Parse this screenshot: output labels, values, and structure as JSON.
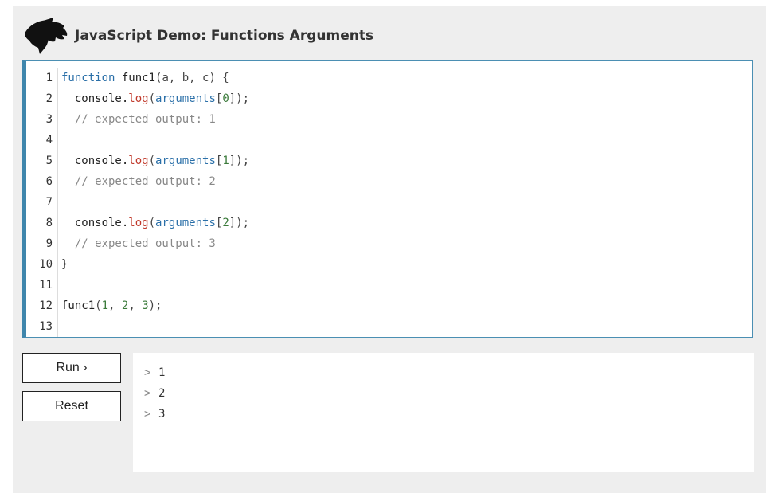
{
  "header": {
    "title": "JavaScript Demo: Functions Arguments",
    "logo_icon": "dinosaur-head-icon"
  },
  "editor": {
    "lines": [
      {
        "n": "1",
        "tokens": [
          [
            "kw",
            "function"
          ],
          [
            "fn",
            " func1"
          ],
          [
            "punc",
            "(a, b, c) {"
          ]
        ]
      },
      {
        "n": "2",
        "tokens": [
          [
            "fn",
            "  console."
          ],
          [
            "prop",
            "log"
          ],
          [
            "punc",
            "("
          ],
          [
            "var",
            "arguments"
          ],
          [
            "punc",
            "["
          ],
          [
            "num",
            "0"
          ],
          [
            "punc",
            "]);"
          ]
        ]
      },
      {
        "n": "3",
        "tokens": [
          [
            "cm",
            "  // expected output: 1"
          ]
        ]
      },
      {
        "n": "4",
        "tokens": []
      },
      {
        "n": "5",
        "tokens": [
          [
            "fn",
            "  console."
          ],
          [
            "prop",
            "log"
          ],
          [
            "punc",
            "("
          ],
          [
            "var",
            "arguments"
          ],
          [
            "punc",
            "["
          ],
          [
            "num",
            "1"
          ],
          [
            "punc",
            "]);"
          ]
        ]
      },
      {
        "n": "6",
        "tokens": [
          [
            "cm",
            "  // expected output: 2"
          ]
        ]
      },
      {
        "n": "7",
        "tokens": []
      },
      {
        "n": "8",
        "tokens": [
          [
            "fn",
            "  console."
          ],
          [
            "prop",
            "log"
          ],
          [
            "punc",
            "("
          ],
          [
            "var",
            "arguments"
          ],
          [
            "punc",
            "["
          ],
          [
            "num",
            "2"
          ],
          [
            "punc",
            "]);"
          ]
        ]
      },
      {
        "n": "9",
        "tokens": [
          [
            "cm",
            "  // expected output: 3"
          ]
        ]
      },
      {
        "n": "10",
        "tokens": [
          [
            "punc",
            "}"
          ]
        ]
      },
      {
        "n": "11",
        "tokens": []
      },
      {
        "n": "12",
        "tokens": [
          [
            "fn",
            "func1"
          ],
          [
            "punc",
            "("
          ],
          [
            "num",
            "1"
          ],
          [
            "punc",
            ", "
          ],
          [
            "num",
            "2"
          ],
          [
            "punc",
            ", "
          ],
          [
            "num",
            "3"
          ],
          [
            "punc",
            ");"
          ]
        ]
      },
      {
        "n": "13",
        "tokens": []
      }
    ]
  },
  "buttons": {
    "run_label": "Run ›",
    "reset_label": "Reset"
  },
  "output": {
    "prompt": ">",
    "lines": [
      "1",
      "2",
      "3"
    ]
  },
  "colors": {
    "frame_bg": "#eeeeee",
    "editor_border": "#3f86ac",
    "keyword": "#2a6fa8",
    "property": "#c0392b",
    "comment": "#888888"
  }
}
